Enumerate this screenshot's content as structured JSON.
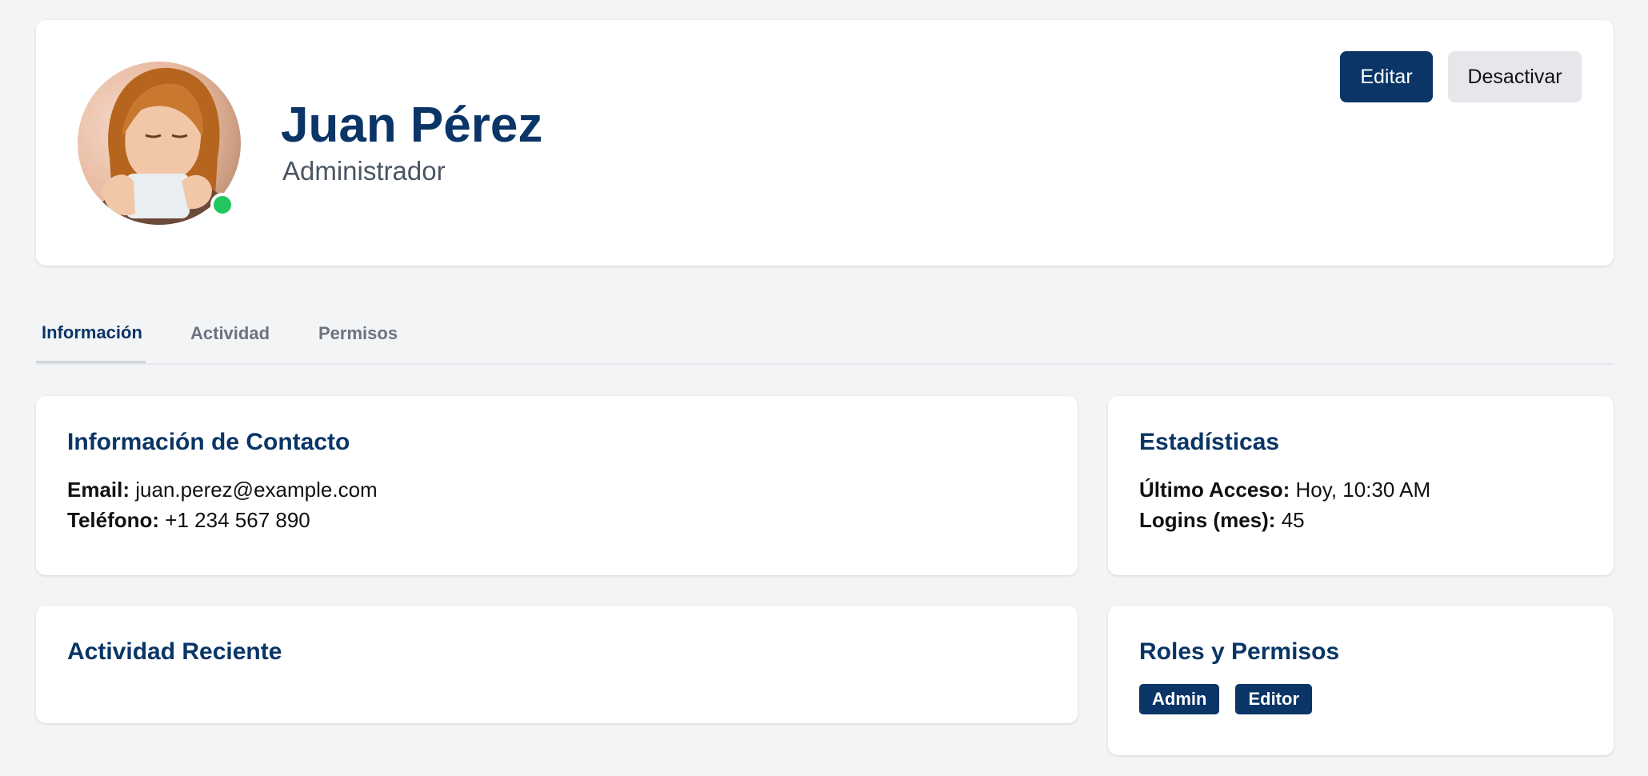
{
  "profile": {
    "name": "Juan Pérez",
    "role": "Administrador",
    "status_color": "#22c55e",
    "avatar_icon": "user-photo-avatar"
  },
  "actions": {
    "edit_label": "Editar",
    "deactivate_label": "Desactivar"
  },
  "tabs": [
    {
      "label": "Información",
      "active": true
    },
    {
      "label": "Actividad",
      "active": false
    },
    {
      "label": "Permisos",
      "active": false
    }
  ],
  "contact": {
    "title": "Información de Contacto",
    "email_label": "Email:",
    "email_value": "juan.perez@example.com",
    "phone_label": "Teléfono:",
    "phone_value": "+1 234 567 890"
  },
  "stats": {
    "title": "Estadísticas",
    "last_access_label": "Último Acceso:",
    "last_access_value": "Hoy, 10:30 AM",
    "logins_label": "Logins (mes):",
    "logins_value": "45"
  },
  "activity": {
    "title": "Actividad Reciente"
  },
  "roles": {
    "title": "Roles y Permisos",
    "badges": [
      "Admin",
      "Editor"
    ]
  },
  "colors": {
    "primary": "#0a3566",
    "background": "#f3f4f6",
    "secondary_button": "#e5e7eb",
    "online": "#22c55e"
  }
}
